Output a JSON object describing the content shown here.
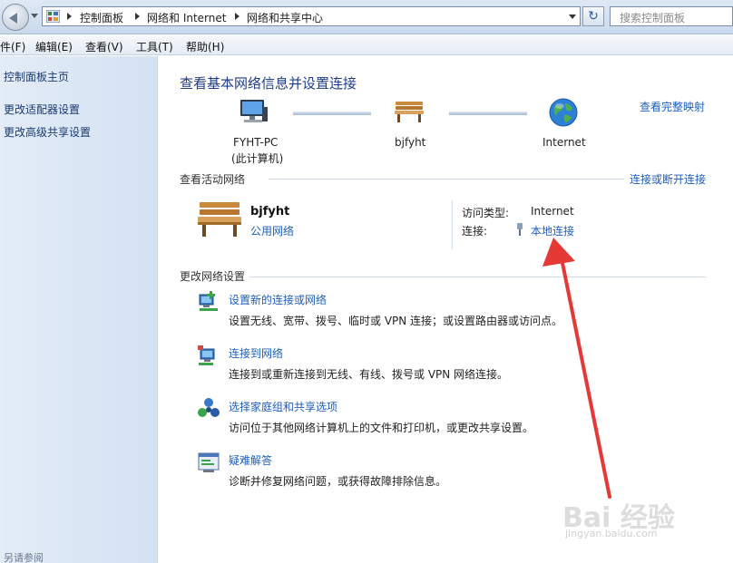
{
  "address_bar": {
    "breadcrumbs": [
      "控制面板",
      "网络和 Internet",
      "网络和共享中心"
    ],
    "search_placeholder": "搜索控制面板"
  },
  "menu": [
    "件(F)",
    "编辑(E)",
    "查看(V)",
    "工具(T)",
    "帮助(H)"
  ],
  "sidebar": {
    "links": [
      "控制面板主页",
      "更改适配器设置",
      "更改高级共享设置"
    ],
    "footer": "另请参阅"
  },
  "main": {
    "title": "查看基本网络信息并设置连接",
    "full_map_link": "查看完整映射",
    "map": {
      "computer_name": "FYHT-PC",
      "computer_sub": "(此计算机)",
      "network_name": "bjfyht",
      "internet_label": "Internet"
    },
    "active_networks": {
      "title": "查看活动网络",
      "connect_link": "连接或断开连接",
      "network_name": "bjfyht",
      "network_type": "公用网络",
      "access_type_label": "访问类型:",
      "access_type_value": "Internet",
      "connections_label": "连接:",
      "connection_link": "本地连接"
    },
    "change_settings": {
      "title": "更改网络设置",
      "tasks": [
        {
          "link": "设置新的连接或网络",
          "desc": "设置无线、宽带、拨号、临时或 VPN 连接；或设置路由器或访问点。",
          "icon": "new-connection-icon"
        },
        {
          "link": "连接到网络",
          "desc": "连接到或重新连接到无线、有线、拨号或 VPN 网络连接。",
          "icon": "connect-network-icon"
        },
        {
          "link": "选择家庭组和共享选项",
          "desc": "访问位于其他网络计算机上的文件和打印机，或更改共享设置。",
          "icon": "homegroup-icon"
        },
        {
          "link": "疑难解答",
          "desc": "诊断并修复网络问题，或获得故障排除信息。",
          "icon": "troubleshoot-icon"
        }
      ]
    }
  },
  "watermark": {
    "text": "Bai 经验",
    "sub": "jingyan.baidu.com"
  },
  "colors": {
    "link": "#1e5fb8",
    "title": "#1f3c88",
    "annotation_arrow": "#e53935"
  }
}
